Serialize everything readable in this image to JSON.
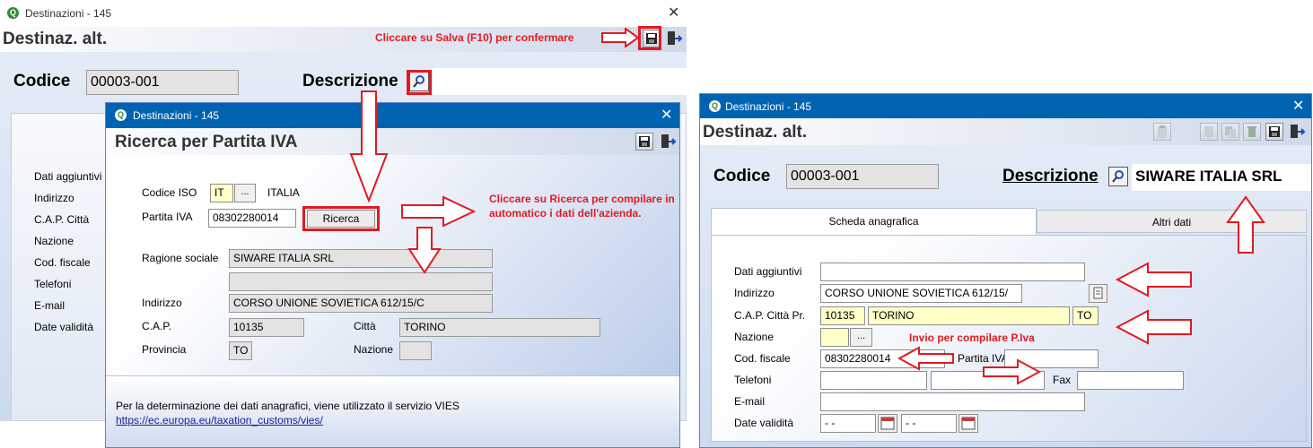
{
  "left_window": {
    "title": "Destinazioni - 145",
    "app_title": "Destinaz. alt.",
    "codice_label": "Codice",
    "codice_value": "00003-001",
    "descrizione_label": "Descrizione",
    "side_labels": [
      "Dati aggiuntivi",
      "Indirizzo",
      "C.A.P.  Città",
      "Nazione",
      "Cod. fiscale",
      "Telefoni",
      "E-mail",
      "Date validità"
    ]
  },
  "dialog": {
    "title": "Destinazioni - 145",
    "app_title": "Ricerca per Partita IVA",
    "codice_iso_label": "Codice ISO",
    "codice_iso_value": "IT",
    "ellipsis": "...",
    "country": "ITALIA",
    "partita_iva_label": "Partita IVA",
    "partita_iva_value": "08302280014",
    "ricerca_button": "Ricerca",
    "ragione_sociale_label": "Ragione sociale",
    "ragione_sociale_value": "SIWARE ITALIA SRL",
    "ragione_sociale_2": "",
    "indirizzo_label": "Indirizzo",
    "indirizzo_value": "CORSO UNIONE SOVIETICA 612/15/C",
    "cap_label": "C.A.P.",
    "cap_value": "10135",
    "citta_label": "Città",
    "citta_value": "TORINO",
    "provincia_label": "Provincia",
    "provincia_value": "TO",
    "nazione_label": "Nazione",
    "nazione_value": "",
    "footer_text": "Per la determinazione dei dati anagrafici, viene utilizzato il servizio VIES",
    "footer_link": "https://ec.europa.eu/taxation_customs/vies/"
  },
  "right_window": {
    "title": "Destinazioni - 145",
    "app_title": "Destinaz. alt.",
    "codice_label": "Codice",
    "codice_value": "00003-001",
    "descrizione_label": "Descrizione",
    "descrizione_value": "SIWARE ITALIA SRL",
    "tabs": [
      {
        "label": "Scheda anagrafica"
      },
      {
        "label": "Altri dati"
      }
    ],
    "dati_aggiuntivi_label": "Dati aggiuntivi",
    "dati_aggiuntivi_value": "",
    "indirizzo_label": "Indirizzo",
    "indirizzo_value": "CORSO UNIONE SOVIETICA 612/15/",
    "cap_citta_label": "C.A.P.  Città  Pr.",
    "cap_value": "10135",
    "citta_value": "TORINO",
    "pr_value": "TO",
    "nazione_label": "Nazione",
    "nazione_value": "",
    "ellipsis": "...",
    "cod_fiscale_label": "Cod. fiscale",
    "cod_fiscale_value": "08302280014",
    "partita_iva_label": "Partita IVA",
    "partita_iva_value": "",
    "telefoni_label": "Telefoni",
    "telefono1": "",
    "telefono2": "",
    "fax_label": "Fax",
    "fax_value": "",
    "email_label": "E-mail",
    "email_value": "",
    "date_validita_label": "Date validità",
    "date_from": "- -",
    "date_to": "- -"
  },
  "annotations": {
    "salva": "Cliccare su Salva (F10) per confermare",
    "ricerca": "Cliccare su Ricerca per compilare in automatico i dati dell'azienda.",
    "invio": "Invio per compilare P.Iva"
  },
  "colors": {
    "annotation_red": "#e01b22",
    "link_blue": "#1a1aa6",
    "field_yellow": "#ffffc6",
    "field_grey": "#e3e3e3",
    "title_blue": "#0063b1"
  }
}
